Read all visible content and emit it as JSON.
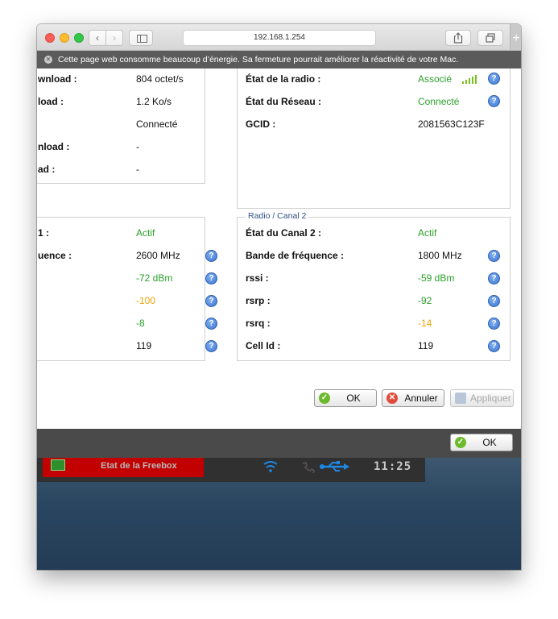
{
  "browser": {
    "address": "192.168.1.254",
    "energy_warning": "Cette page web consomme beaucoup d’énergie. Sa fermeture pourrait améliorer la réactivité de votre Mac."
  },
  "upper_left": {
    "rows": [
      {
        "label": "wnload :",
        "value": "804 octet/s"
      },
      {
        "label": "load :",
        "value": "1.2 Ko/s"
      },
      {
        "label": "",
        "value": "Connecté"
      },
      {
        "label": "nload :",
        "value": "-"
      },
      {
        "label": "ad :",
        "value": "-"
      }
    ]
  },
  "upper_right": {
    "rows": [
      {
        "label": "État de la radio :",
        "value": "Associé"
      },
      {
        "label": "État du Réseau :",
        "value": "Connecté"
      },
      {
        "label": "GCID :",
        "value": "2081563C123F"
      }
    ],
    "signal_bars": 5
  },
  "lower_left": {
    "rows": [
      {
        "label": "1 :",
        "value": "Actif"
      },
      {
        "label": "uence :",
        "value": "2600 MHz"
      },
      {
        "label": "",
        "value": "-72 dBm"
      },
      {
        "label": "",
        "value": "-100"
      },
      {
        "label": "",
        "value": "-8"
      },
      {
        "label": "",
        "value": "119"
      }
    ]
  },
  "lower_right": {
    "legend": "Radio / Canal 2",
    "rows": [
      {
        "label": "État du Canal 2 :",
        "value": "Actif"
      },
      {
        "label": "Bande de fréquence :",
        "value": "1800 MHz"
      },
      {
        "label": "rssi :",
        "value": "-59 dBm"
      },
      {
        "label": "rsrp :",
        "value": "-92"
      },
      {
        "label": "rsrq :",
        "value": "-14"
      },
      {
        "label": "Cell Id :",
        "value": "119"
      }
    ]
  },
  "help_glyph": "?",
  "dialog_buttons": {
    "ok": "OK",
    "cancel": "Annuler",
    "apply": "Appliquer"
  },
  "outer_ok": "OK",
  "freebox": {
    "title": "Etat de la Freebox",
    "clock": "11:25"
  },
  "colors": {
    "green": "#2aa02a",
    "orange": "#f0a000",
    "legend": "#2d4f86",
    "red_panel": "#c20000"
  }
}
